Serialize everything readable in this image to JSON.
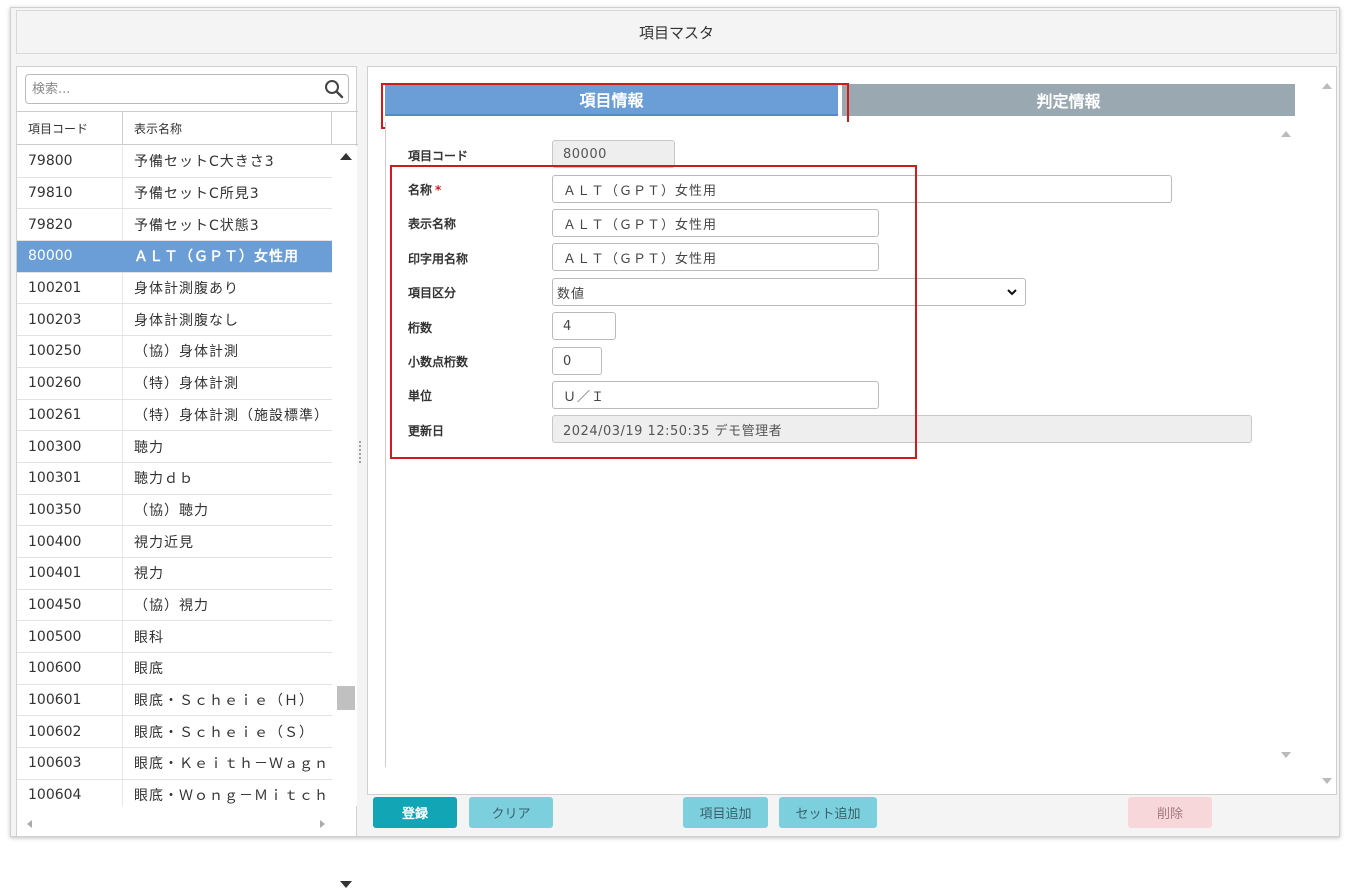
{
  "window": {
    "title": "項目マスタ"
  },
  "search": {
    "placeholder": "検索..."
  },
  "list": {
    "headers": {
      "code": "項目コード",
      "name": "表示名称"
    },
    "rows": [
      {
        "code": "79800",
        "name": "予備セットC大きさ3"
      },
      {
        "code": "79810",
        "name": "予備セットC所見3"
      },
      {
        "code": "79820",
        "name": "予備セットC状態3"
      },
      {
        "code": "80000",
        "name": "ＡＬＴ（ＧＰＴ）女性用",
        "selected": true
      },
      {
        "code": "100201",
        "name": "身体計測腹あり"
      },
      {
        "code": "100203",
        "name": "身体計測腹なし"
      },
      {
        "code": "100250",
        "name": "（協）身体計測"
      },
      {
        "code": "100260",
        "name": "（特）身体計測"
      },
      {
        "code": "100261",
        "name": "（特）身体計測（施設標準）"
      },
      {
        "code": "100300",
        "name": "聴力"
      },
      {
        "code": "100301",
        "name": "聴力ｄｂ"
      },
      {
        "code": "100350",
        "name": "（協）聴力"
      },
      {
        "code": "100400",
        "name": "視力近見"
      },
      {
        "code": "100401",
        "name": "視力"
      },
      {
        "code": "100450",
        "name": "（協）視力"
      },
      {
        "code": "100500",
        "name": "眼科"
      },
      {
        "code": "100600",
        "name": "眼底"
      },
      {
        "code": "100601",
        "name": "眼底・Ｓｃｈｅｉｅ（Ｈ）"
      },
      {
        "code": "100602",
        "name": "眼底・Ｓｃｈｅｉｅ（Ｓ）"
      },
      {
        "code": "100603",
        "name": "眼底・Ｋｅｉｔｈ－Ｗａｇｎｅｒ"
      },
      {
        "code": "100604",
        "name": "眼底・Ｗｏｎｇ－Ｍｉｔｃｈｅｌｌ"
      }
    ]
  },
  "tabs": {
    "item_info": "項目情報",
    "judge_info": "判定情報"
  },
  "form": {
    "code_label": "項目コード",
    "code_value": "80000",
    "name_label": "名称",
    "required_mark": "*",
    "name_value": "ＡＬＴ（ＧＰＴ）女性用",
    "display_name_label": "表示名称",
    "display_name_value": "ＡＬＴ（ＧＰＴ）女性用",
    "print_name_label": "印字用名称",
    "print_name_value": "ＡＬＴ（ＧＰＴ）女性用",
    "category_label": "項目区分",
    "category_value": "数値",
    "digits_label": "桁数",
    "digits_value": "4",
    "decimal_label": "小数点桁数",
    "decimal_value": "0",
    "unit_label": "単位",
    "unit_value": "Ｕ／Ｉ",
    "updated_label": "更新日",
    "updated_value": "2024/03/19 12:50:35 デモ管理者"
  },
  "buttons": {
    "register": "登録",
    "clear": "クリア",
    "add_item": "項目追加",
    "add_set": "セット追加",
    "delete": "削除"
  },
  "colors": {
    "selected_row": "#6b9ed6",
    "tab_active": "#6b9ed6",
    "tab_inactive": "#9aa8b1",
    "primary": "#12a5b5",
    "highlight": "#d11b1b"
  }
}
